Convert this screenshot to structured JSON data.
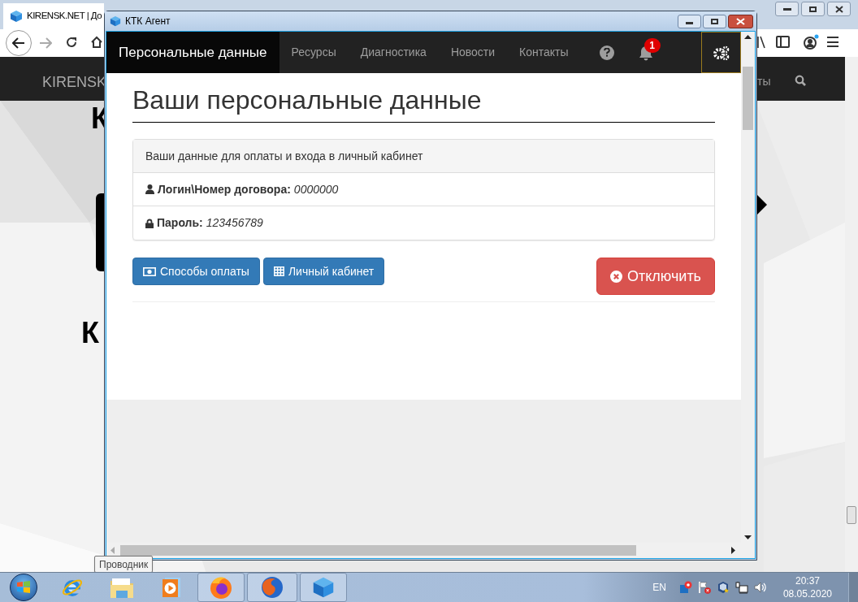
{
  "browser": {
    "tab_title": "KIRENSK.NET | До",
    "site_nav": {
      "logo": "KIRENSK",
      "right_text": "ты"
    },
    "page_letters": [
      "К",
      "К"
    ]
  },
  "app_window": {
    "title": "КТК Агент",
    "nav": [
      {
        "label": "Персональные данные",
        "selected": true
      },
      {
        "label": "Ресурсы",
        "selected": false
      },
      {
        "label": "Диагностика",
        "selected": false
      },
      {
        "label": "Новости",
        "selected": false
      },
      {
        "label": "Контакты",
        "selected": false
      }
    ],
    "notification_count": "1",
    "heading": "Ваши персональные данные",
    "panel": {
      "header": "Ваши данные для оплаты и входа в личный кабинет",
      "rows": [
        {
          "kind": "login",
          "label": "Логин\\Номер договора:",
          "value": "0000000"
        },
        {
          "kind": "password",
          "label": "Пароль:",
          "value": "123456789"
        }
      ]
    },
    "buttons": [
      {
        "kind": "payment",
        "label": "Способы оплаты"
      },
      {
        "kind": "cabinet",
        "label": "Личный кабинет"
      }
    ],
    "disconnect_button": "Отключить"
  },
  "tooltip": "Проводник",
  "taskbar": {
    "apps": [
      {
        "kind": "ie",
        "selected": false
      },
      {
        "kind": "explorer",
        "selected": false
      },
      {
        "kind": "media",
        "selected": false
      },
      {
        "kind": "firefox-new",
        "selected": true
      },
      {
        "kind": "firefox-old",
        "selected": true
      },
      {
        "kind": "cube",
        "selected": true
      }
    ],
    "language": "EN",
    "time": "20:37",
    "date": "08.05.2020"
  }
}
